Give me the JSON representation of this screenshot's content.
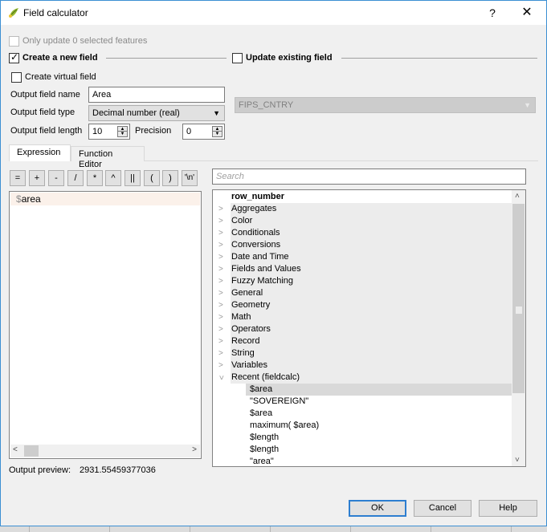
{
  "window": {
    "title": "Field calculator",
    "help_label": "?",
    "close_label": "✕"
  },
  "options": {
    "only_update_selected": {
      "label": "Only update 0 selected features",
      "checked": false,
      "enabled": false
    },
    "create_new_field": {
      "label": "Create a new field",
      "checked": true
    },
    "update_existing_field": {
      "label": "Update existing field",
      "checked": false
    },
    "create_virtual_field": {
      "label": "Create virtual field",
      "checked": false
    }
  },
  "new_field": {
    "name_label": "Output field name",
    "name_value": "Area",
    "type_label": "Output field type",
    "type_value": "Decimal number (real)",
    "length_label": "Output field length",
    "length_value": "10",
    "precision_label": "Precision",
    "precision_value": "0"
  },
  "existing_field": {
    "selected": "FIPS_CNTRY",
    "enabled": false
  },
  "tabs": [
    {
      "label": "Expression",
      "active": true
    },
    {
      "label": "Function Editor",
      "active": false
    }
  ],
  "operators": [
    "=",
    "+",
    "-",
    "/",
    "*",
    "^",
    "||",
    "(",
    ")",
    "'\\n'"
  ],
  "expression": {
    "text_prefix": "$",
    "text_rest": "area"
  },
  "search": {
    "placeholder": "Search",
    "value": ""
  },
  "function_tree": {
    "header": "row_number",
    "groups": [
      "Aggregates",
      "Color",
      "Conditionals",
      "Conversions",
      "Date and Time",
      "Fields and Values",
      "Fuzzy Matching",
      "General",
      "Geometry",
      "Math",
      "Operators",
      "Record",
      "String",
      "Variables"
    ],
    "expanded_group": "Recent (fieldcalc)",
    "recent_items": [
      "$area",
      "\"SOVEREIGN\"",
      "$area",
      "maximum( $area)",
      "$length",
      "$length",
      "\"area\""
    ],
    "selected_index": 0
  },
  "preview": {
    "label": "Output preview:",
    "value": "2931.55459377036"
  },
  "buttons": {
    "ok": "OK",
    "cancel": "Cancel",
    "help": "Help"
  },
  "colors": {
    "accent": "#2d7ed0",
    "window_border": "#3c8fd3"
  }
}
